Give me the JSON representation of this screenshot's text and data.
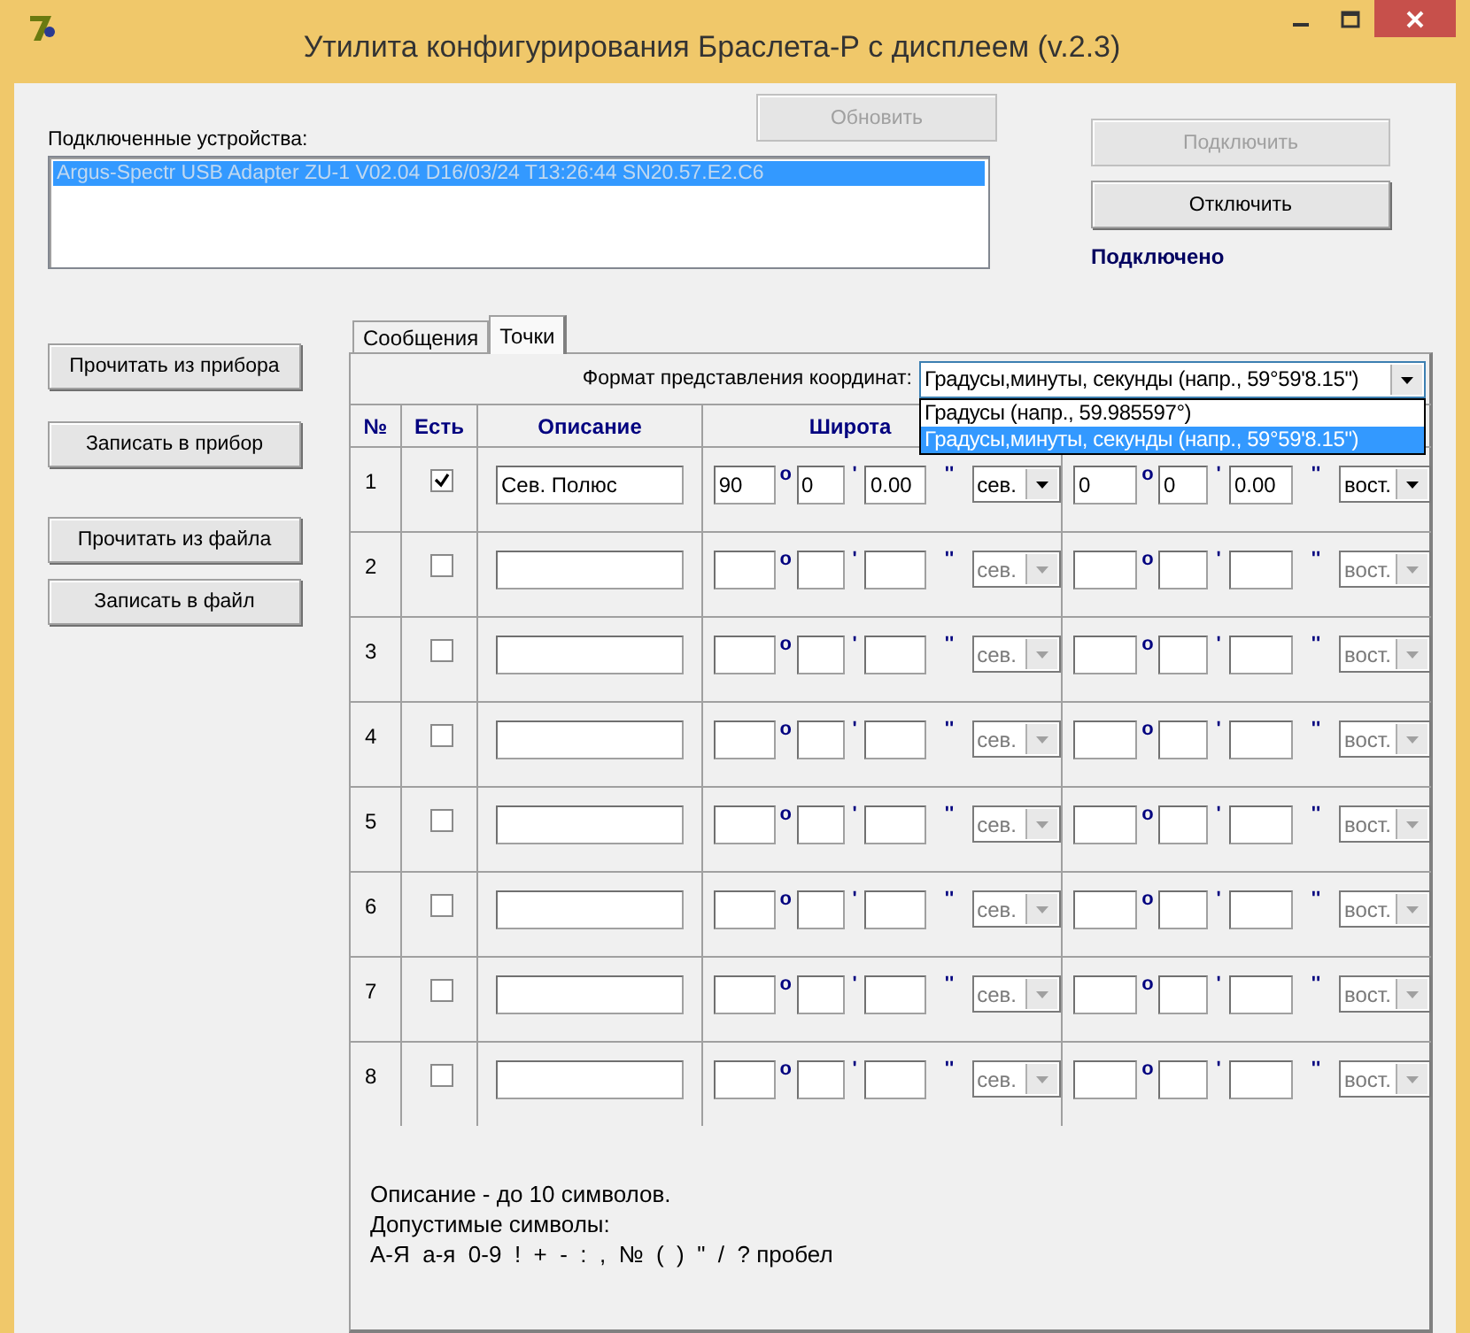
{
  "window": {
    "title": "Утилита конфигурирования Браслета-Р  с дисплеем (v.2.3)"
  },
  "refresh_button": {
    "label": "Обновить",
    "disabled": true
  },
  "devices": {
    "label": "Подключенные устройства:",
    "items": [
      {
        "text": "Argus-Spectr USB Adapter ZU-1 V02.04 D16/03/24 T13:26:44 SN20.57.E2.C6",
        "selected": true
      }
    ]
  },
  "connect_buttons": [
    {
      "label": "Подключить",
      "disabled": true
    },
    {
      "label": "Отключить",
      "disabled": false
    }
  ],
  "status": "Подключено",
  "actions": [
    {
      "label": "Прочитать из прибора"
    },
    {
      "label": "Записать в прибор"
    },
    {
      "label": "Прочитать из файла"
    },
    {
      "label": "Записать в файл"
    }
  ],
  "tabs": [
    {
      "label": "Сообщения",
      "selected": false
    },
    {
      "label": "Точки",
      "selected": true
    }
  ],
  "format": {
    "label": "Формат представления координат:",
    "value": "Градусы,минуты, секунды (напр., 59°59'8.15\")",
    "expanded": true,
    "options": [
      {
        "text": "Градусы  (напр., 59.985597°)",
        "selected": false
      },
      {
        "text": "Градусы,минуты, секунды (напр., 59°59'8.15\")",
        "selected": true
      }
    ]
  },
  "columns": [
    "№",
    "Есть",
    "Описание",
    "Широта"
  ],
  "rows": [
    {
      "number": "1",
      "checked": true,
      "description": "Сев. Полюс",
      "latitude": {
        "degrees": "90",
        "deg_mark": "o",
        "minutes": "0",
        "min_mark": "'",
        "seconds": "0.00",
        "sec_mark": "''",
        "hemisphere": "сев."
      },
      "longitude": {
        "degrees": "0",
        "deg_mark": "o",
        "minutes": "0",
        "min_mark": "'",
        "seconds": "0.00",
        "sec_mark": "''",
        "hemisphere": "вост."
      }
    },
    {
      "number": "2",
      "checked": false,
      "latitude": {
        "deg_mark": "o",
        "min_mark": "'",
        "sec_mark": "''",
        "hemisphere": "сев."
      },
      "longitude": {
        "deg_mark": "o",
        "min_mark": "'",
        "sec_mark": "''",
        "hemisphere": "вост."
      }
    },
    {
      "number": "3",
      "checked": false,
      "latitude": {
        "deg_mark": "o",
        "min_mark": "'",
        "sec_mark": "''",
        "hemisphere": "сев."
      },
      "longitude": {
        "deg_mark": "o",
        "min_mark": "'",
        "sec_mark": "''",
        "hemisphere": "вост."
      }
    },
    {
      "number": "4",
      "checked": false,
      "latitude": {
        "deg_mark": "o",
        "min_mark": "'",
        "sec_mark": "''",
        "hemisphere": "сев."
      },
      "longitude": {
        "deg_mark": "o",
        "min_mark": "'",
        "sec_mark": "''",
        "hemisphere": "вост."
      }
    },
    {
      "number": "5",
      "checked": false,
      "latitude": {
        "deg_mark": "o",
        "min_mark": "'",
        "sec_mark": "''",
        "hemisphere": "сев."
      },
      "longitude": {
        "deg_mark": "o",
        "min_mark": "'",
        "sec_mark": "''",
        "hemisphere": "вост."
      }
    },
    {
      "number": "6",
      "checked": false,
      "latitude": {
        "deg_mark": "o",
        "min_mark": "'",
        "sec_mark": "''",
        "hemisphere": "сев."
      },
      "longitude": {
        "deg_mark": "o",
        "min_mark": "'",
        "sec_mark": "''",
        "hemisphere": "вост."
      }
    },
    {
      "number": "7",
      "checked": false,
      "latitude": {
        "deg_mark": "o",
        "min_mark": "'",
        "sec_mark": "''",
        "hemisphere": "сев."
      },
      "longitude": {
        "deg_mark": "o",
        "min_mark": "'",
        "sec_mark": "''",
        "hemisphere": "вост."
      }
    },
    {
      "number": "8",
      "checked": false,
      "latitude": {
        "deg_mark": "o",
        "min_mark": "'",
        "sec_mark": "''",
        "hemisphere": "сев."
      },
      "longitude": {
        "deg_mark": "o",
        "min_mark": "'",
        "sec_mark": "''",
        "hemisphere": "вост."
      }
    }
  ],
  "notes": [
    "Описание - до 10 символов.",
    "Допустимые символы:",
    "А-Я  а-я  0-9  !  +  -  :  ,  №  (  )  \"  /  ? пробел"
  ]
}
